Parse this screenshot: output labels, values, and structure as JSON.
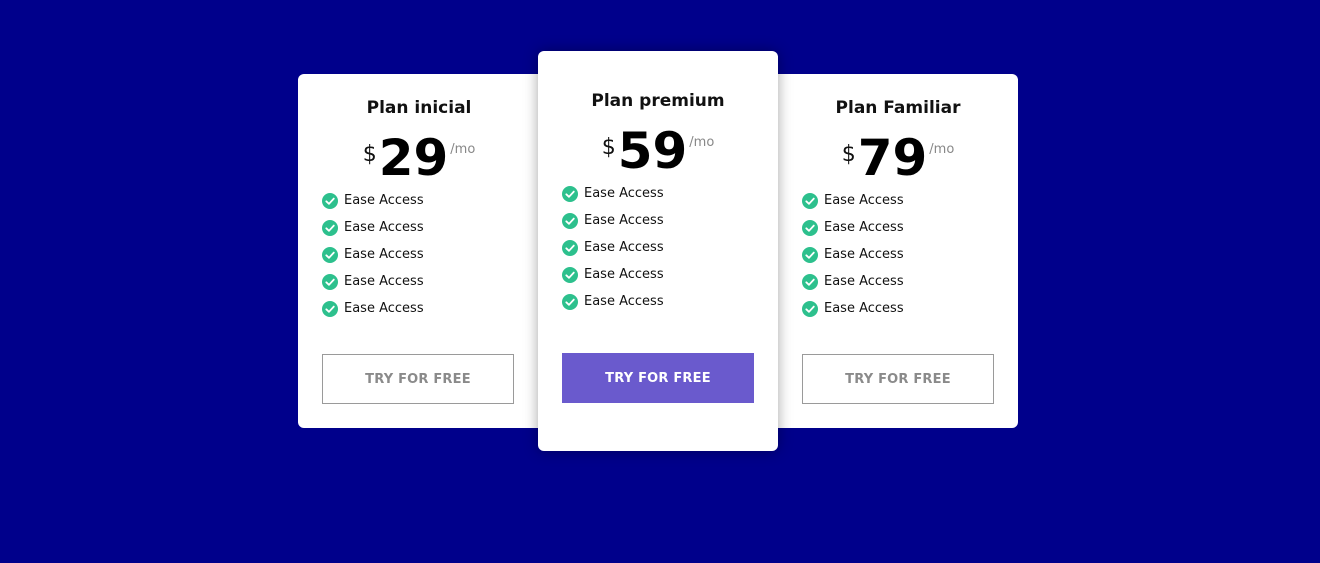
{
  "colors": {
    "background": "#00008b",
    "card": "#ffffff",
    "accent": "#6a5acd",
    "check": "#2dc08d",
    "muted": "#888888"
  },
  "plans": [
    {
      "title": "Plan inicial",
      "currency": "$",
      "price": "29",
      "period": "/mo",
      "features": [
        "Ease Access",
        "Ease Access",
        "Ease Access",
        "Ease Access",
        "Ease Access"
      ],
      "cta": "TRY FOR FREE"
    },
    {
      "title": "Plan premium",
      "currency": "$",
      "price": "59",
      "period": "/mo",
      "features": [
        "Ease Access",
        "Ease Access",
        "Ease Access",
        "Ease Access",
        "Ease Access"
      ],
      "cta": "TRY FOR FREE"
    },
    {
      "title": "Plan Familiar",
      "currency": "$",
      "price": "79",
      "period": "/mo",
      "features": [
        "Ease Access",
        "Ease Access",
        "Ease Access",
        "Ease Access",
        "Ease Access"
      ],
      "cta": "TRY FOR FREE"
    }
  ]
}
